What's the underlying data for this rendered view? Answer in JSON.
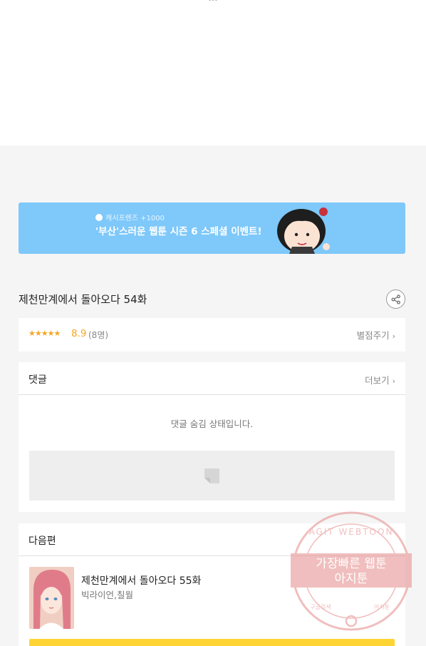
{
  "top": {
    "cut_text": "…"
  },
  "banner": {
    "sub_label": "캐시프렌즈 +1000",
    "title": "'부산'스러운 웹툰 시즌 6 스페셜 이벤트!",
    "colors": {
      "background": "#7ec8fa"
    }
  },
  "episode": {
    "title": "제천만계에서 돌아오다 54화",
    "share_icon": "share-icon"
  },
  "rating": {
    "stars": "★★★★★",
    "score": "8.9",
    "count": "(8명)",
    "rate_label": "별점주기",
    "score_value": 8.9,
    "star_fraction": 0.89
  },
  "comments": {
    "header": "댓글",
    "more_label": "더보기",
    "hidden_message": "댓글 숨김 상태입니다."
  },
  "next": {
    "header": "다음편",
    "item": {
      "title": "제천만계에서 돌아오다 55화",
      "authors": "빅라이언,칠월"
    },
    "button_color": "#fdd434"
  },
  "watermark": {
    "arc_text": "AGIT WEBTOON",
    "line1": "가장빠른 웹툰",
    "line2": "아지툰",
    "bottom_left": "구글검색",
    "bottom_right": "아지툰"
  }
}
